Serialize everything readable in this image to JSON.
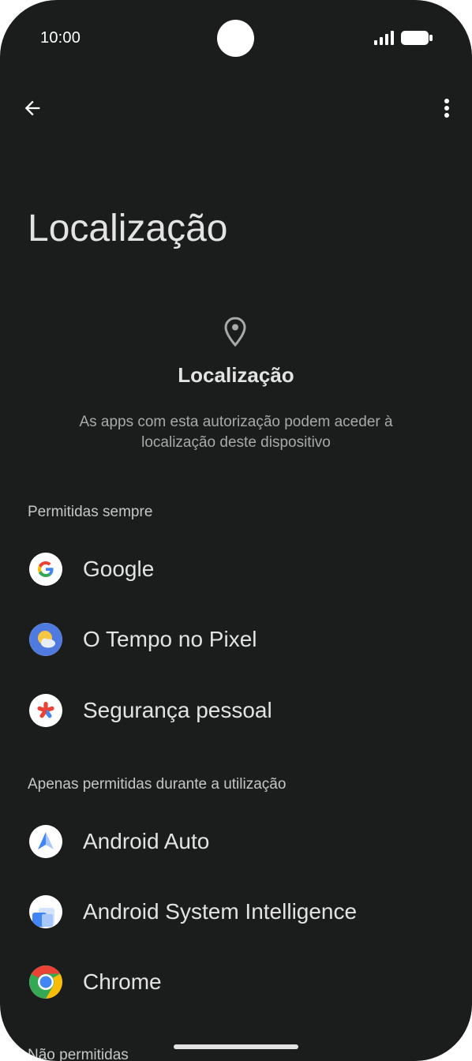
{
  "status_bar": {
    "time": "10:00"
  },
  "toolbar": {
    "back_icon": "arrow-back-icon",
    "more_icon": "more-vert-icon"
  },
  "page": {
    "title": "Localização"
  },
  "header": {
    "icon": "location-pin-icon",
    "title": "Localização",
    "description": "As apps com esta autorização podem aceder à localização deste dispositivo"
  },
  "sections": [
    {
      "label": "Permitidas sempre",
      "apps": [
        {
          "name": "Google",
          "icon": "google-icon"
        },
        {
          "name": "O Tempo no Pixel",
          "icon": "weather-icon"
        },
        {
          "name": "Segurança pessoal",
          "icon": "personal-safety-icon"
        }
      ]
    },
    {
      "label": "Apenas permitidas durante a utilização",
      "apps": [
        {
          "name": "Android Auto",
          "icon": "android-auto-icon"
        },
        {
          "name": "Android System Intelligence",
          "icon": "android-system-intelligence-icon"
        },
        {
          "name": "Chrome",
          "icon": "chrome-icon"
        }
      ]
    },
    {
      "label": "Não permitidas"
    }
  ],
  "colors": {
    "background": "#1b1c1c",
    "text_primary": "#e3e3e3",
    "text_secondary": "#c4c7c5"
  }
}
